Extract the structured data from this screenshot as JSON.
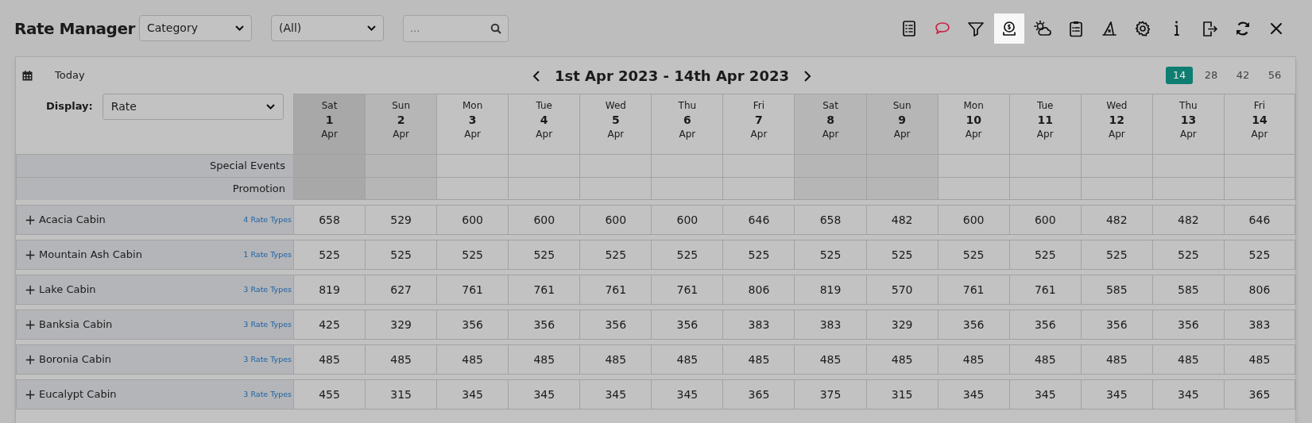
{
  "title": "Rate Manager",
  "filters": [
    {
      "kind": "dropdown",
      "value": "Category"
    },
    {
      "kind": "dropdown",
      "value": "(All)"
    },
    {
      "kind": "search",
      "placeholder": "..."
    }
  ],
  "toolbar": [
    {
      "kind": "checklist",
      "selected": false
    },
    {
      "kind": "chat",
      "selected": false
    },
    {
      "kind": "filter",
      "selected": false
    },
    {
      "kind": "coin",
      "selected": true
    },
    {
      "kind": "weather",
      "selected": false
    },
    {
      "kind": "clipboard",
      "selected": false
    },
    {
      "kind": "hat",
      "selected": false
    },
    {
      "kind": "settings",
      "selected": false
    },
    {
      "kind": "info",
      "selected": false
    },
    {
      "kind": "exit",
      "selected": false
    },
    {
      "kind": "refresh",
      "selected": false
    },
    {
      "kind": "close",
      "selected": false
    }
  ],
  "today_button": "Today",
  "date_range": "1st Apr 2023 - 14th Apr 2023",
  "period_buttons": [
    {
      "label": "14",
      "selected": true
    },
    {
      "label": "28",
      "selected": false
    },
    {
      "label": "42",
      "selected": false
    },
    {
      "label": "56",
      "selected": false
    }
  ],
  "display": {
    "label": "Display:",
    "value": "Rate"
  },
  "days": [
    {
      "weekday": "Sat",
      "day": "1",
      "month": "Apr",
      "weekend": true,
      "selected": true
    },
    {
      "weekday": "Sun",
      "day": "2",
      "month": "Apr",
      "weekend": true,
      "selected": false
    },
    {
      "weekday": "Mon",
      "day": "3",
      "month": "Apr",
      "weekend": false,
      "selected": false
    },
    {
      "weekday": "Tue",
      "day": "4",
      "month": "Apr",
      "weekend": false,
      "selected": false
    },
    {
      "weekday": "Wed",
      "day": "5",
      "month": "Apr",
      "weekend": false,
      "selected": false
    },
    {
      "weekday": "Thu",
      "day": "6",
      "month": "Apr",
      "weekend": false,
      "selected": false
    },
    {
      "weekday": "Fri",
      "day": "7",
      "month": "Apr",
      "weekend": false,
      "selected": false
    },
    {
      "weekday": "Sat",
      "day": "8",
      "month": "Apr",
      "weekend": true,
      "selected": false
    },
    {
      "weekday": "Sun",
      "day": "9",
      "month": "Apr",
      "weekend": true,
      "selected": false
    },
    {
      "weekday": "Mon",
      "day": "10",
      "month": "Apr",
      "weekend": false,
      "selected": false
    },
    {
      "weekday": "Tue",
      "day": "11",
      "month": "Apr",
      "weekend": false,
      "selected": false
    },
    {
      "weekday": "Wed",
      "day": "12",
      "month": "Apr",
      "weekend": false,
      "selected": false
    },
    {
      "weekday": "Thu",
      "day": "13",
      "month": "Apr",
      "weekend": false,
      "selected": false
    },
    {
      "weekday": "Fri",
      "day": "14",
      "month": "Apr",
      "weekend": false,
      "selected": false
    }
  ],
  "info_rows": [
    "Special Events",
    "Promotion"
  ],
  "categories": [
    {
      "expander": "+",
      "name": "Acacia Cabin",
      "rate_types": "4 Rate Types",
      "rates": [
        "658",
        "529",
        "600",
        "600",
        "600",
        "600",
        "646",
        "658",
        "482",
        "600",
        "600",
        "482",
        "482",
        "646"
      ]
    },
    {
      "expander": "+",
      "name": "Mountain Ash Cabin",
      "rate_types": "1 Rate Types",
      "rates": [
        "525",
        "525",
        "525",
        "525",
        "525",
        "525",
        "525",
        "525",
        "525",
        "525",
        "525",
        "525",
        "525",
        "525"
      ]
    },
    {
      "expander": "+",
      "name": "Lake Cabin",
      "rate_types": "3 Rate Types",
      "rates": [
        "819",
        "627",
        "761",
        "761",
        "761",
        "761",
        "806",
        "819",
        "570",
        "761",
        "761",
        "585",
        "585",
        "806"
      ]
    },
    {
      "expander": "+",
      "name": "Banksia Cabin",
      "rate_types": "3 Rate Types",
      "rates": [
        "425",
        "329",
        "356",
        "356",
        "356",
        "356",
        "383",
        "383",
        "329",
        "356",
        "356",
        "356",
        "356",
        "383"
      ]
    },
    {
      "expander": "+",
      "name": "Boronia Cabin",
      "rate_types": "3 Rate Types",
      "rates": [
        "485",
        "485",
        "485",
        "485",
        "485",
        "485",
        "485",
        "485",
        "485",
        "485",
        "485",
        "485",
        "485",
        "485"
      ]
    },
    {
      "expander": "+",
      "name": "Eucalypt Cabin",
      "rate_types": "3 Rate Types",
      "rates": [
        "455",
        "315",
        "345",
        "345",
        "345",
        "345",
        "365",
        "375",
        "315",
        "345",
        "345",
        "345",
        "345",
        "365"
      ]
    }
  ]
}
